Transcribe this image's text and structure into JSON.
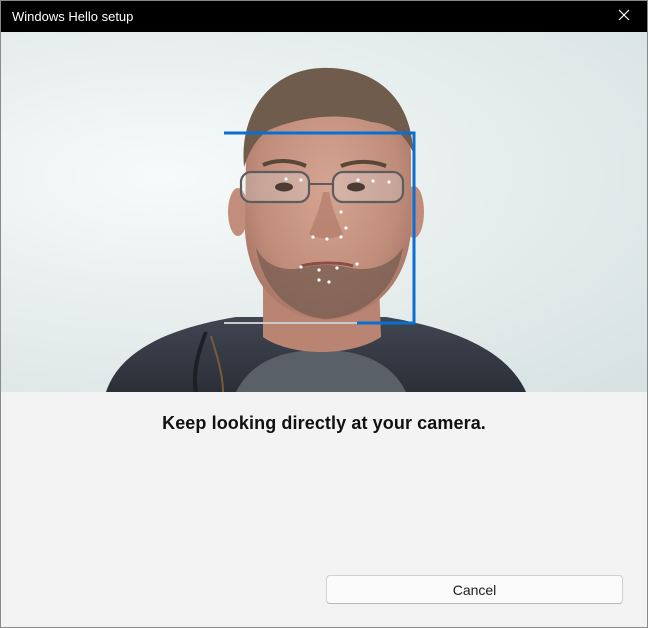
{
  "window": {
    "title": "Windows Hello setup"
  },
  "camera": {
    "frame_color": "#0a6fd1",
    "progress": 0.65
  },
  "instruction": "Keep looking directly at your camera.",
  "actions": {
    "cancel_label": "Cancel"
  },
  "icons": {
    "close": "close-icon"
  }
}
